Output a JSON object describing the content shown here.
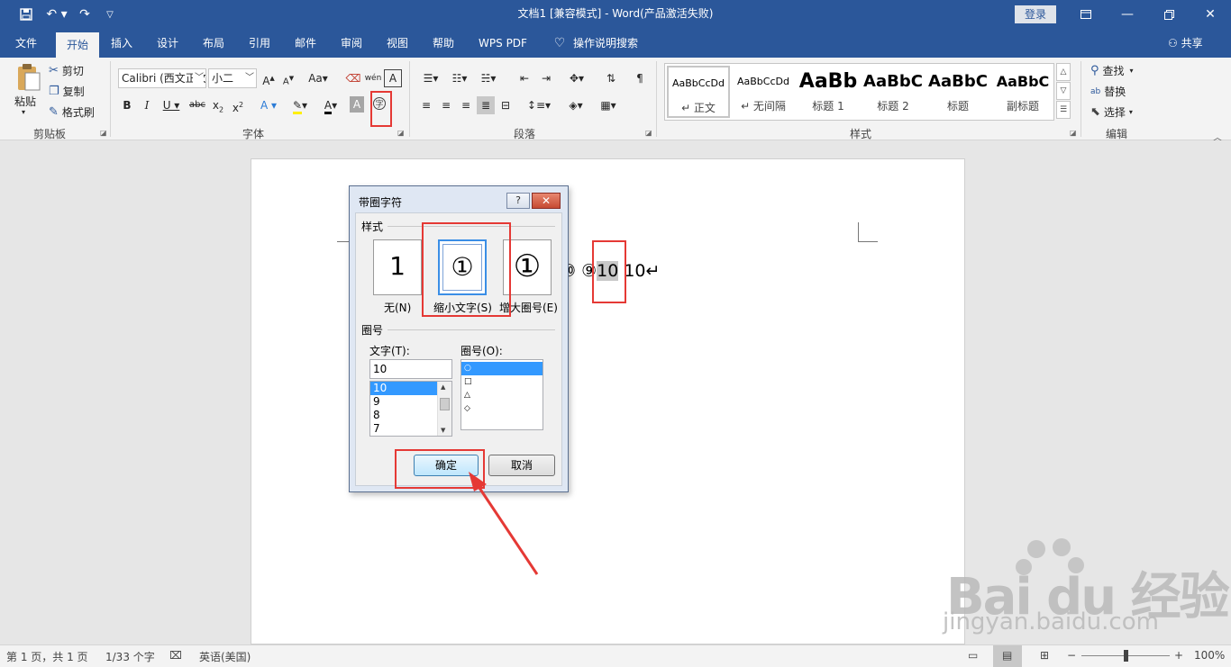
{
  "titlebar": {
    "title": "文档1 [兼容模式] - Word(产品激活失败)",
    "login": "登录",
    "save_icon": "save-icon",
    "undo_icon": "undo-icon",
    "redo_icon": "redo-icon"
  },
  "tabs": [
    "文件",
    "开始",
    "插入",
    "设计",
    "布局",
    "引用",
    "邮件",
    "审阅",
    "视图",
    "帮助",
    "WPS PDF",
    "操作说明搜索"
  ],
  "share": "共享",
  "clipboard": {
    "label": "剪贴板",
    "paste": "粘贴",
    "cut": "剪切",
    "copy": "复制",
    "format_painter": "格式刷"
  },
  "font": {
    "label": "字体",
    "font_name": "Calibri (西文正文)",
    "font_size": "小二"
  },
  "paragraph": {
    "label": "段落"
  },
  "styles": {
    "label": "样式",
    "items": [
      {
        "sample": "AaBbCcDd",
        "name": "↵ 正文"
      },
      {
        "sample": "AaBbCcDd",
        "name": "↵ 无间隔"
      },
      {
        "sample": "AaBb",
        "name": "标题 1"
      },
      {
        "sample": "AaBbC",
        "name": "标题 2"
      },
      {
        "sample": "AaBbC",
        "name": "标题"
      },
      {
        "sample": "AaBbC",
        "name": "副标题"
      }
    ]
  },
  "editing": {
    "label": "编辑",
    "find": "查找",
    "replace": "替换",
    "select": "选择"
  },
  "document": {
    "text_before": "⑩ ⑨",
    "selected_text": "10",
    "text_after": " 10↵"
  },
  "dialog": {
    "title": "带圈字符",
    "help": "?",
    "close": "✕",
    "style_section": "样式",
    "style_options": [
      {
        "glyph": "1",
        "label": "无(N)"
      },
      {
        "glyph": "①",
        "label": "缩小文字(S)"
      },
      {
        "glyph": "①",
        "label": "增大圈号(E)"
      }
    ],
    "circle_section": "圈号",
    "text_label": "文字(T):",
    "text_value": "10",
    "text_list": [
      "10",
      "9",
      "8",
      "7"
    ],
    "enclosure_label": "圈号(O):",
    "enclosure_list": [
      "○",
      "□",
      "△",
      "◇"
    ],
    "ok": "确定",
    "cancel": "取消"
  },
  "statusbar": {
    "page": "第 1 页，共 1 页",
    "words": "1/33 个字",
    "language": "英语(美国)",
    "zoom": "100%"
  },
  "watermark": {
    "brand": "Bai du 经验",
    "url": "jingyan.baidu.com"
  }
}
